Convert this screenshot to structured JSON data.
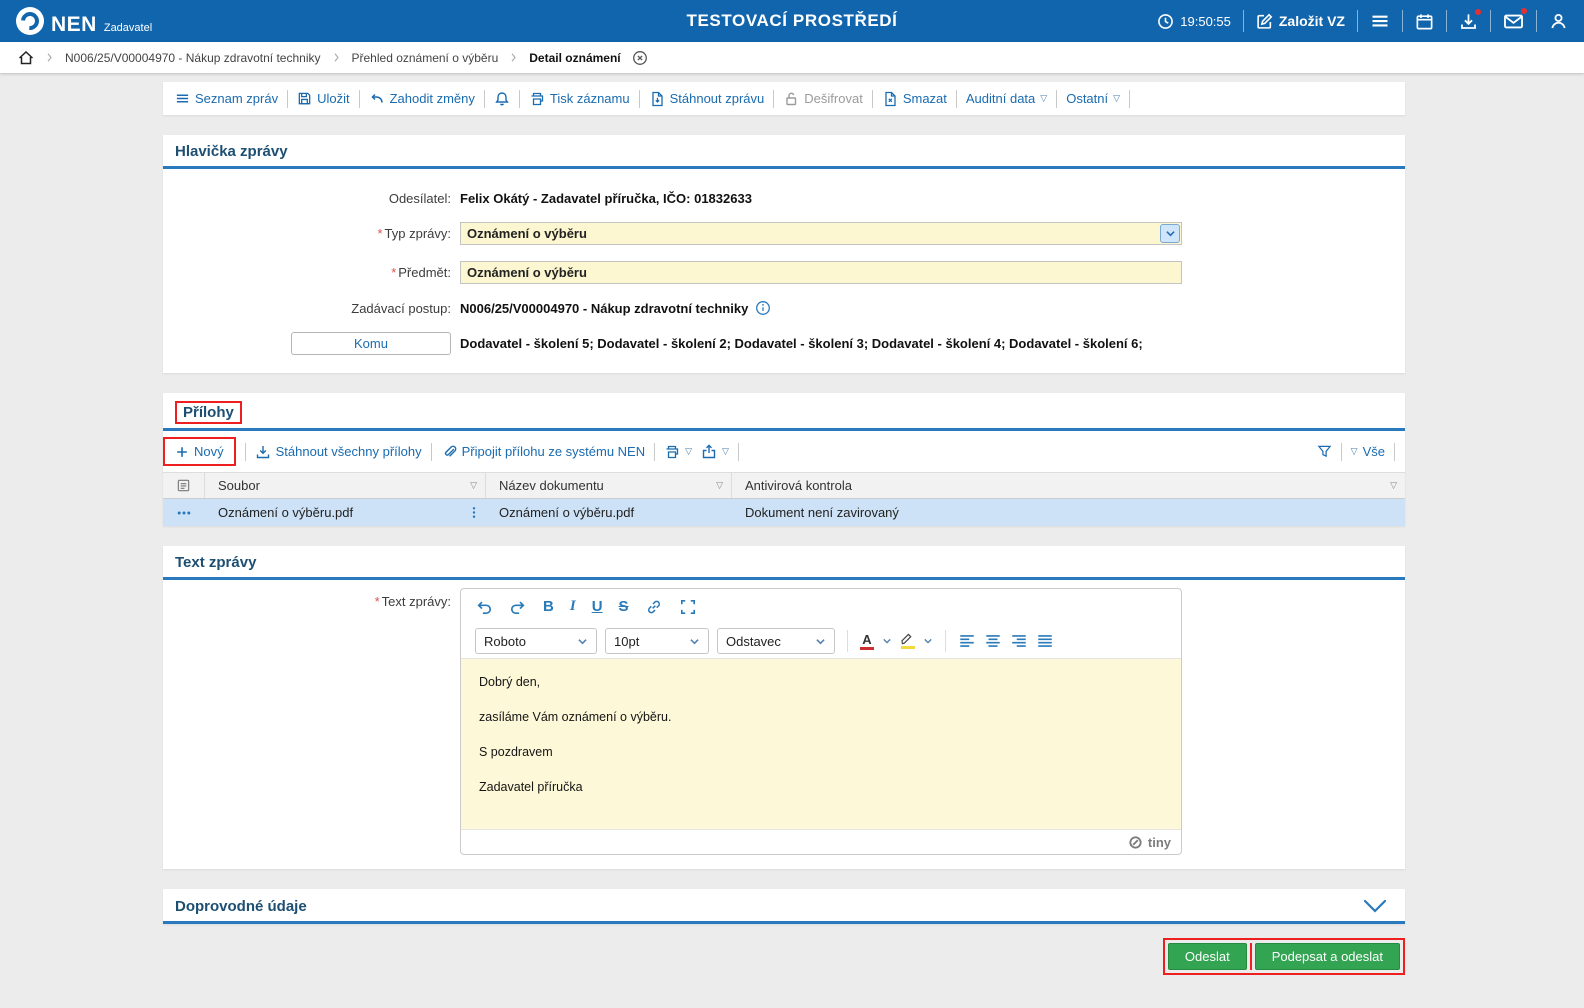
{
  "ui": {
    "required_marker": "*"
  },
  "header": {
    "brand": "NEN",
    "brand_sub": "Zadavatel",
    "env_title": "TESTOVACÍ PROSTŘEDÍ",
    "time": "19:50:55",
    "create_vz_label": "Založit VZ"
  },
  "breadcrumb": {
    "items": [
      "N006/25/V00004970 - Nákup zdravotní techniky",
      "Přehled oznámení o výběru",
      "Detail oznámení"
    ]
  },
  "toolbar": {
    "seznam_zprav": "Seznam zpráv",
    "ulozit": "Uložit",
    "zahodit_zmeny": "Zahodit změny",
    "tisk_zaznamu": "Tisk záznamu",
    "stahnout_zpravu": "Stáhnout zprávu",
    "desifrovat": "Dešifrovat",
    "smazat": "Smazat",
    "auditni_data": "Auditní data",
    "ostatni": "Ostatní"
  },
  "message_header": {
    "title": "Hlavička zprávy",
    "odesilatel_label": "Odesílatel:",
    "odesilatel_value": "Felix Okátý - Zadavatel příručka, IČO: 01832633",
    "typ_zpravy_label": "Typ zprávy:",
    "typ_zpravy_value": "Oznámení o výběru",
    "predmet_label": "Předmět:",
    "predmet_value": "Oznámení o výběru",
    "zadavaci_postup_label": "Zadávací postup:",
    "zadavaci_postup_value": "N006/25/V00004970 - Nákup zdravotní techniky",
    "komu_label": "Komu",
    "komu_value": "Dodavatel - školení 5; Dodavatel - školení 2; Dodavatel - školení 3; Dodavatel - školení 4; Dodavatel - školení 6;"
  },
  "attachments": {
    "title": "Přílohy",
    "novy": "Nový",
    "stahnout_vsechny": "Stáhnout všechny přílohy",
    "pripojit": "Připojit přílohu ze systému NEN",
    "vse": "Vše",
    "columns": {
      "soubor": "Soubor",
      "nazev": "Název dokumentu",
      "antivir": "Antivirová kontrola"
    },
    "rows": [
      {
        "soubor": "Oznámení o výběru.pdf",
        "nazev": "Oznámení o výběru.pdf",
        "antivir": "Dokument není zavirovaný"
      }
    ]
  },
  "message_text": {
    "title": "Text zprávy",
    "label": "Text zprávy:",
    "editor": {
      "bold": "B",
      "italic": "I",
      "underline": "U",
      "strike": "S",
      "font_family": "Roboto",
      "font_size": "10pt",
      "block_format": "Odstavec",
      "color_letter": "A",
      "paragraphs": [
        "Dobrý den,",
        "zasíláme Vám oznámení o výběru.",
        "S pozdravem",
        "Zadavatel příručka"
      ],
      "brand": "tiny"
    }
  },
  "doprovodne": {
    "title": "Doprovodné údaje"
  },
  "actions": {
    "odeslat": "Odeslat",
    "podepsat_a_odeslat": "Podepsat a odeslat"
  }
}
